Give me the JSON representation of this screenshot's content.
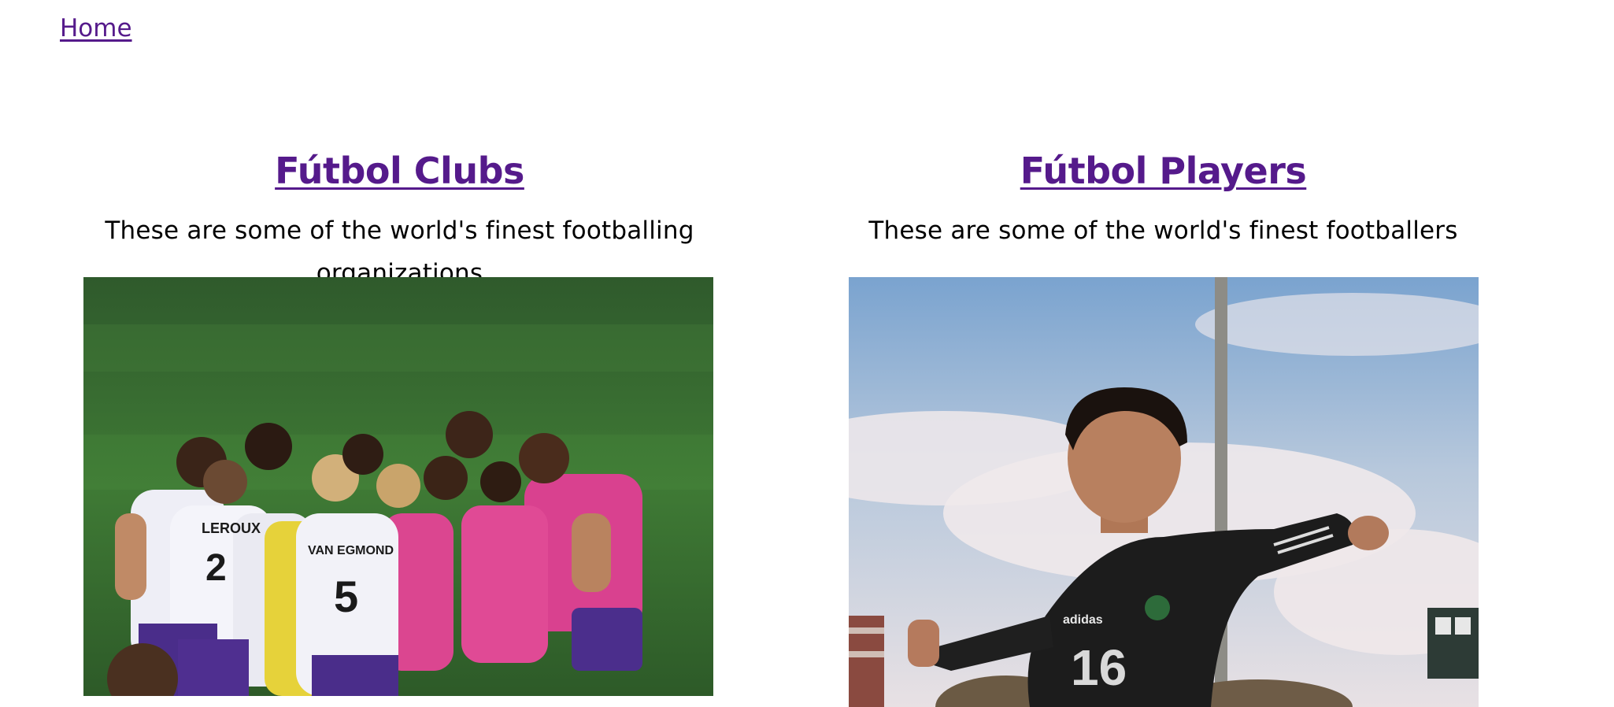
{
  "nav": {
    "home_label": "Home"
  },
  "cards": [
    {
      "title": "Fútbol Clubs",
      "description": "These are some of the world's finest footballing organizations",
      "image": {
        "jersey_names": [
          "LEROUX",
          "VAN EGMOND"
        ],
        "jersey_numbers": [
          "2",
          "5"
        ]
      }
    },
    {
      "title": "Fútbol Players",
      "description": "These are some of the world's finest footballers",
      "image": {
        "jersey_brand": "adidas",
        "jersey_number": "16"
      }
    }
  ],
  "colors": {
    "link": "#551a8b",
    "text": "#000000",
    "background": "#ffffff"
  }
}
